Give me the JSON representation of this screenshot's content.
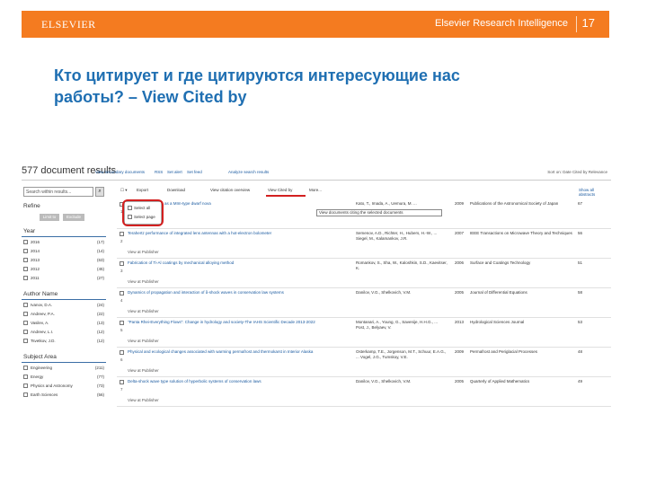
{
  "slide": {
    "brand_logo": "ELSEVIER",
    "brand_right": "Elsevier Research Intelligence",
    "page_number": "17",
    "title_line1": "Кто цитирует и где цитируются интересующие нас",
    "title_line2": "работы? – View Cited by"
  },
  "results": {
    "count_label": "577 document results",
    "links": [
      "View secondary documents",
      "RSS",
      "Set alert",
      "Set feed",
      "Analyze search results"
    ],
    "sort_label": "Sort on: Date  Cited by  Relevance"
  },
  "sidebar": {
    "search_placeholder": "Search within results...",
    "search_icon": "search-icon",
    "refine_heading": "Refine",
    "limit_button": "Limit to",
    "exclude_button": "Exclude",
    "groups": [
      {
        "heading": "Year",
        "items": [
          {
            "label": "2016",
            "count": "(17)"
          },
          {
            "label": "2014",
            "count": "(14)"
          },
          {
            "label": "2013",
            "count": "(63)"
          },
          {
            "label": "2012",
            "count": "(45)"
          },
          {
            "label": "2011",
            "count": "(27)"
          }
        ]
      },
      {
        "heading": "Author Name",
        "items": [
          {
            "label": "Ivanov, D.A.",
            "count": "(24)"
          },
          {
            "label": "Andreev, P.A.",
            "count": "(22)"
          },
          {
            "label": "Vasilev, A.",
            "count": "(13)"
          },
          {
            "label": "Andreev, L.I.",
            "count": "(12)"
          },
          {
            "label": "Tsvetkov, J.D.",
            "count": "(12)"
          }
        ]
      },
      {
        "heading": "Subject Area",
        "items": [
          {
            "label": "Engineering",
            "count": "(211)"
          },
          {
            "label": "Energy",
            "count": "(77)"
          },
          {
            "label": "Physics and Astronomy",
            "count": "(73)"
          },
          {
            "label": "Earth Sciences",
            "count": "(56)"
          }
        ]
      }
    ]
  },
  "toolbar": {
    "items": [
      "Export",
      "Download",
      "View citation overview",
      "View Cited by",
      "More..."
    ],
    "show_all_abstracts": "Show all abstracts"
  },
  "select_dropdown": {
    "items": [
      "Select all",
      "Select page"
    ]
  },
  "tooltip": "View documents citing the selected documents",
  "view_at_publisher": "View at Publisher",
  "documents": [
    {
      "n": "1",
      "title": "Characteristics of ... as a MIm-type dwarf nova",
      "authors": "Kato, T., Imada, A., Uemura, M. ...",
      "year": "2009",
      "source": "Publications of the Astronomical Society of Japan",
      "cited": "67"
    },
    {
      "n": "2",
      "title": "Terahertz performance of integrated lens antennas with a hot-electron bolometer",
      "authors": "Semenov, A.D., Richter, H., Hubers, H.-W., ... Siegel, M., Kalamankov, J.R.",
      "year": "2007",
      "source": "IEEE Transactions on Microwave Theory and Techniques",
      "cited": "56"
    },
    {
      "n": "3",
      "title": "Fabrication of Ti-Al coatings by mechanical alloying method",
      "authors": "Romankov, S., Sha, W., Kaloshkin, S.D., Kaevitser, K.",
      "year": "2006",
      "source": "Surface and Coatings Technology",
      "cited": "51"
    },
    {
      "n": "4",
      "title": "Dynamics of propagation and interaction of δ-shock waves in conservation law systems",
      "authors": "Danilov, V.G., Shelkovich, V.M.",
      "year": "2005",
      "source": "Journal of Differential Equations",
      "cited": "58"
    },
    {
      "n": "5",
      "title": "\"Panta Rhei-Everything Flows\": Change in hydrology and society-The IAHS Scientific Decade 2013-2022",
      "authors": "Montanari, A., Young, G., Savenije, H.H.G., ... Post, J., Belyaev, V.",
      "year": "2013",
      "source": "Hydrological Sciences Journal",
      "cited": "53"
    },
    {
      "n": "6",
      "title": "Physical and ecological changes associated with warming permafrost and thermokarst in Interior Alaska",
      "authors": "Osterkamp, T.E., Jorgenson, M.T., Schuur, E.A.G., ... Vogel, J.G., Tumskoy, V.E.",
      "year": "2009",
      "source": "Permafrost and Periglacial Processes",
      "cited": "48"
    },
    {
      "n": "7",
      "title": "Delta-shock wave type solution of hyperbolic systems of conservation laws",
      "authors": "Danilov, V.G., Shelkovich, V.M.",
      "year": "2005",
      "source": "Quarterly of Applied Mathematics",
      "cited": "49"
    }
  ],
  "colors": {
    "brand_orange": "#f47b20",
    "title_blue": "#1f6fb2",
    "link_blue": "#1a5aa0",
    "highlight_red": "#d32020"
  }
}
